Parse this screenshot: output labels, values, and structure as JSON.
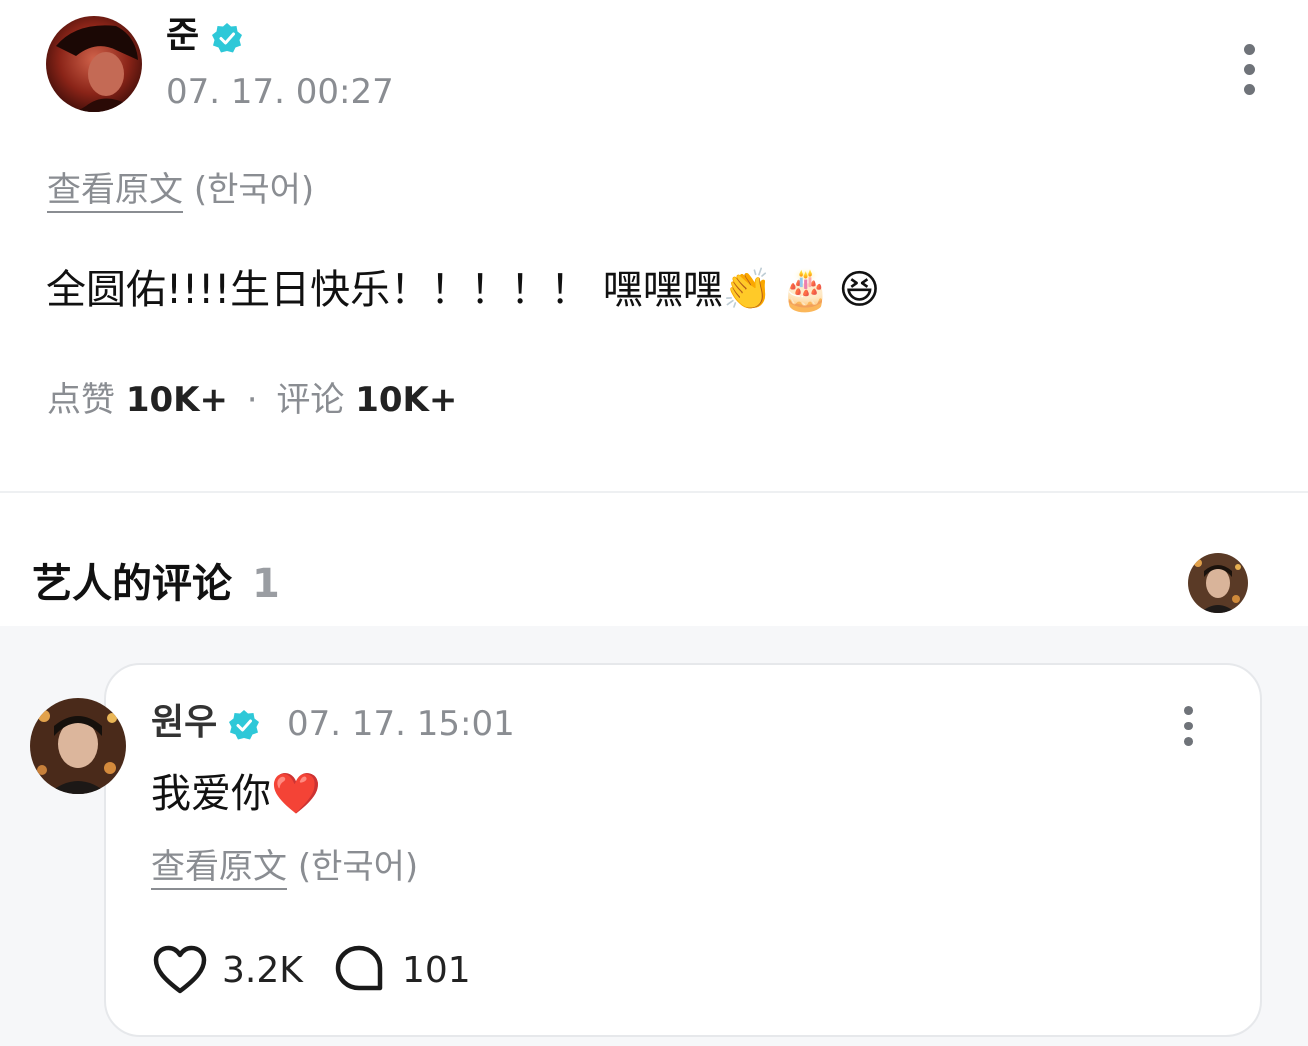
{
  "post": {
    "author": "준",
    "timestamp": "07. 17. 00:27",
    "translate_link": "查看原文",
    "translate_lang": "(한국어)",
    "body_text": "全圆佑!!!!生日快乐！！！！！ 嘿嘿嘿",
    "emojis": [
      "👏",
      "🎂",
      "😆"
    ],
    "likes_label": "点赞",
    "likes_count": "10K+",
    "separator": "·",
    "comments_label": "评论",
    "comments_count": "10K+"
  },
  "artist_comments": {
    "title": "艺人的评论",
    "count": "1"
  },
  "comment": {
    "author": "원우",
    "timestamp": "07. 17. 15:01",
    "text": "我爱你",
    "emoji": "❤️",
    "translate_link": "查看原文",
    "translate_lang": "(한국어)",
    "like_count": "3.2K",
    "reply_count": "101"
  },
  "colors": {
    "verified": "#2ec8d8",
    "muted_text": "#8a8d92",
    "comment_section_bg": "#f6f7f9",
    "card_border": "#e6e8eb"
  }
}
